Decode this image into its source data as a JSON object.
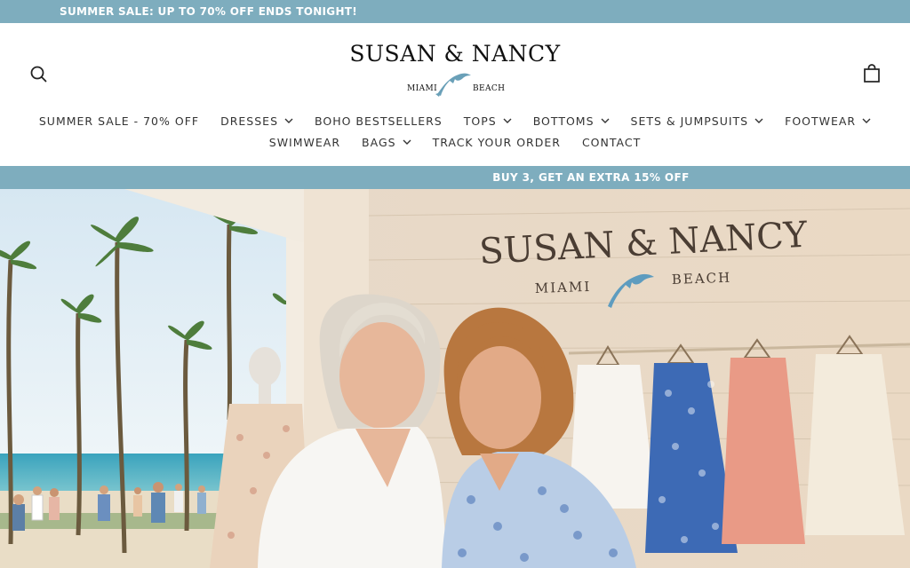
{
  "announcement": {
    "text": "SUMMER SALE: UP TO 70% OFF ENDS TONIGHT!"
  },
  "logo": {
    "main": "SUSAN & NANCY",
    "left": "MIAMI",
    "right": "BEACH"
  },
  "icons": {
    "search": "search-icon",
    "cart": "shopping-bag-icon",
    "dropdown": "chevron-down-icon",
    "logo_mark": "dolphin-icon"
  },
  "nav": {
    "row1": [
      {
        "label": "SUMMER SALE - 70% OFF",
        "dropdown": false
      },
      {
        "label": "DRESSES",
        "dropdown": true
      },
      {
        "label": "BOHO BESTSELLERS",
        "dropdown": false
      },
      {
        "label": "TOPS",
        "dropdown": true
      },
      {
        "label": "BOTTOMS",
        "dropdown": true
      },
      {
        "label": "SETS & JUMPSUITS",
        "dropdown": true
      },
      {
        "label": "FOOTWEAR",
        "dropdown": true
      }
    ],
    "row2": [
      {
        "label": "SWIMWEAR",
        "dropdown": false
      },
      {
        "label": "BAGS",
        "dropdown": true
      },
      {
        "label": "TRACK YOUR ORDER",
        "dropdown": false
      },
      {
        "label": "CONTACT",
        "dropdown": false
      }
    ]
  },
  "promo": {
    "text": "BUY 3, GET AN EXTRA 15% OFF"
  },
  "hero": {
    "wall_main": "SUSAN & NANCY",
    "wall_left": "MIAMI",
    "wall_right": "BEACH"
  },
  "colors": {
    "accent": "#7eadbe",
    "dolphin": "#6aa0b8",
    "text": "#333333"
  }
}
